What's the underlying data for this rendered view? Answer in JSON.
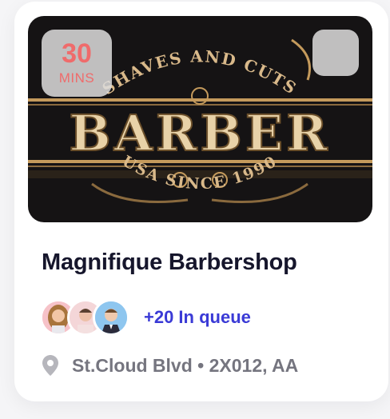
{
  "card": {
    "wait": {
      "value": "30",
      "unit": "MINS"
    },
    "hero_image": {
      "top_text": "SHAVES AND CUTS",
      "main_text": "BARBER",
      "bottom_text": "USA SINCE 1990"
    },
    "bookmark_icon": "bookmark-icon",
    "title": "Magnifique Barbershop",
    "queue_text": "+20 In queue",
    "address": "St.Cloud Blvd • 2X012, AA",
    "location_icon": "map-pin-icon"
  },
  "colors": {
    "accent_red": "#ef6b6b",
    "accent_blue": "#3a3ad6",
    "title_text": "#16162c",
    "muted_text": "#75757f",
    "gold": "#c49a5c",
    "hero_bg": "#151314"
  }
}
